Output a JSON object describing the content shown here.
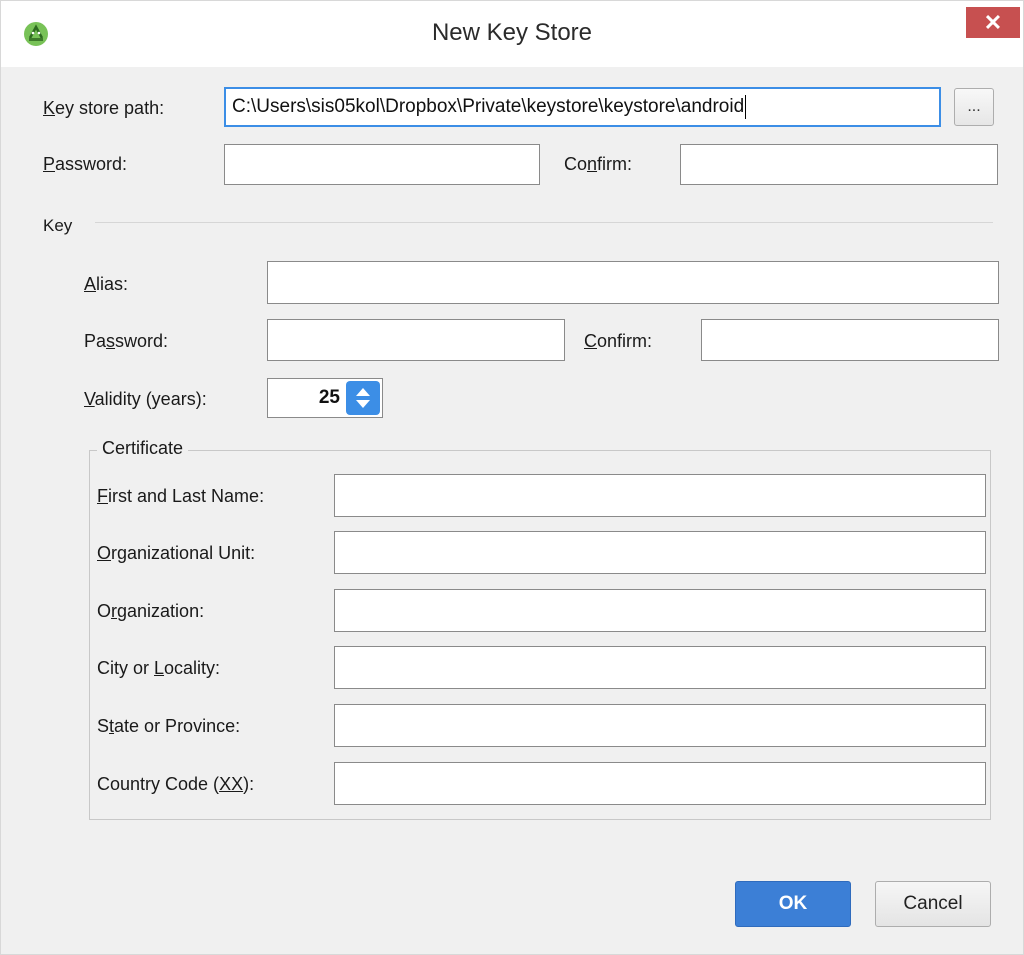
{
  "window": {
    "title": "New Key Store",
    "close_symbol": "✕"
  },
  "keystore": {
    "path_label_pre": "",
    "path_label_u": "K",
    "path_label_post": "ey store path:",
    "path_value": "C:\\Users\\sis05kol\\Dropbox\\Private\\keystore\\keystore\\android",
    "browse_label": "...",
    "password_label_u": "P",
    "password_label_post": "assword:",
    "password_value": "",
    "confirm_label_pre": "Co",
    "confirm_label_u": "n",
    "confirm_label_post": "firm:",
    "confirm_value": ""
  },
  "key": {
    "section_label": "Key",
    "alias_label_u": "A",
    "alias_label_post": "lias:",
    "alias_value": "",
    "password_label_pre": "Pa",
    "password_label_u": "s",
    "password_label_post": "sword:",
    "password_value": "",
    "confirm_label_u": "C",
    "confirm_label_post": "onfirm:",
    "confirm_value": "",
    "validity_label_u": "V",
    "validity_label_post": "alidity (years):",
    "validity_value": "25"
  },
  "certificate": {
    "legend": "Certificate",
    "fields": [
      {
        "pre": "",
        "u": "F",
        "post": "irst and Last Name:",
        "value": ""
      },
      {
        "pre": "",
        "u": "O",
        "post": "rganizational Unit:",
        "value": ""
      },
      {
        "pre": "O",
        "u": "r",
        "post": "ganization:",
        "value": ""
      },
      {
        "pre": "City or ",
        "u": "L",
        "post": "ocality:",
        "value": ""
      },
      {
        "pre": "S",
        "u": "t",
        "post": "ate or Province:",
        "value": ""
      },
      {
        "pre": "Country Code (",
        "u": "XX",
        "post": "):",
        "value": ""
      }
    ]
  },
  "buttons": {
    "ok": "OK",
    "cancel": "Cancel"
  },
  "colors": {
    "accent": "#3c8ee6",
    "ok_button": "#3c7fd6",
    "close_button": "#c75050"
  },
  "icons": {
    "app": "android-studio-icon",
    "close": "close-icon",
    "spinner": "spinner-arrows-icon"
  }
}
